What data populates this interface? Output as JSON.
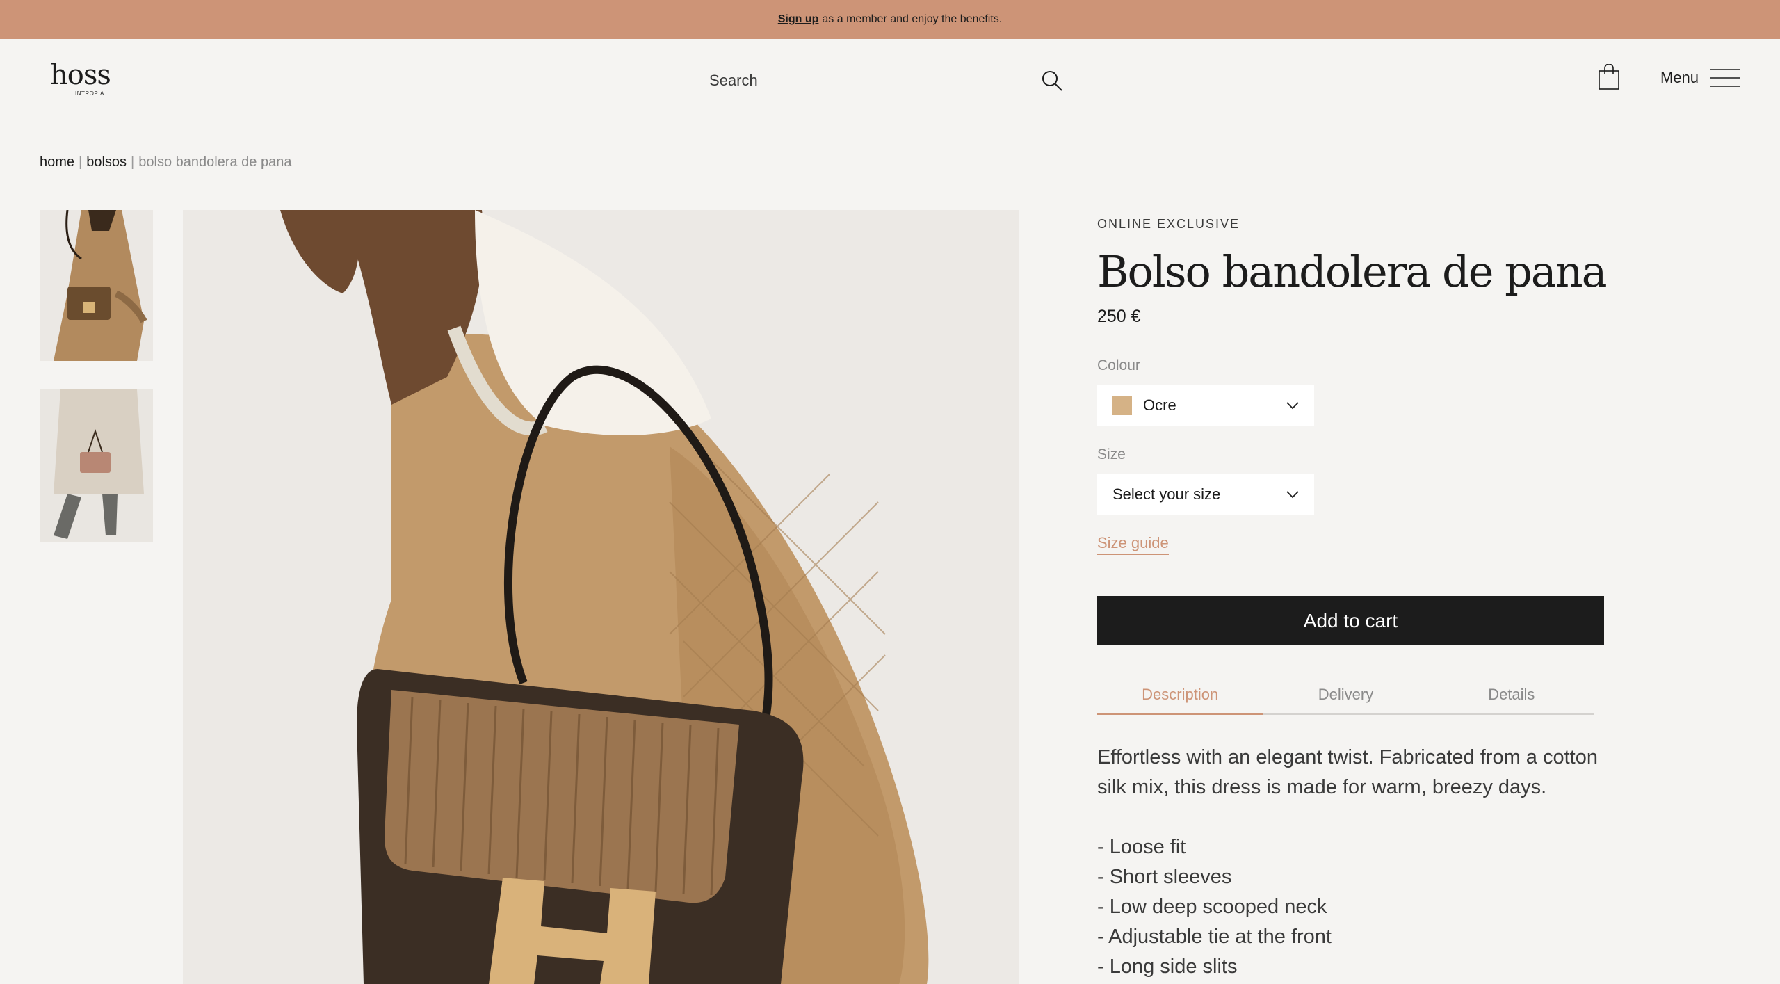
{
  "announcement": {
    "link": "Sign up",
    "text": "as a member and enjoy the benefits."
  },
  "header": {
    "logo_word": "hoss",
    "logo_sub": "INTROPIA",
    "search_placeholder": "Search",
    "menu_label": "Menu"
  },
  "breadcrumb": {
    "home": "home",
    "category": "bolsos",
    "current": "bolso bandolera de pana",
    "separator": "|"
  },
  "product": {
    "tag": "ONLINE EXCLUSIVE",
    "title": "Bolso bandolera de pana",
    "price": "250 €",
    "colour_label": "Colour",
    "colour_value": "Ocre",
    "colour_swatch": "#d5b286",
    "size_label": "Size",
    "size_value": "Select your size",
    "size_guide": "Size guide",
    "add_to_cart": "Add to cart"
  },
  "tabs": [
    {
      "label": "Description",
      "active": true
    },
    {
      "label": "Delivery",
      "active": false
    },
    {
      "label": "Details",
      "active": false
    }
  ],
  "description": {
    "text": "Effortless with an elegant twist. Fabricated from a cotton silk mix, this dress is made for warm, breezy days.",
    "bullets": [
      "- Loose fit",
      "- Short sleeves",
      "- Low deep scooped neck",
      "- Adjustable tie at the front",
      "- Long side slits"
    ]
  },
  "colors": {
    "accent": "#cd9477",
    "background": "#f5f4f2",
    "button": "#1c1c1c"
  },
  "icons": [
    "search-icon",
    "shopping-bag-icon",
    "hamburger-menu-icon",
    "chevron-down-icon"
  ]
}
